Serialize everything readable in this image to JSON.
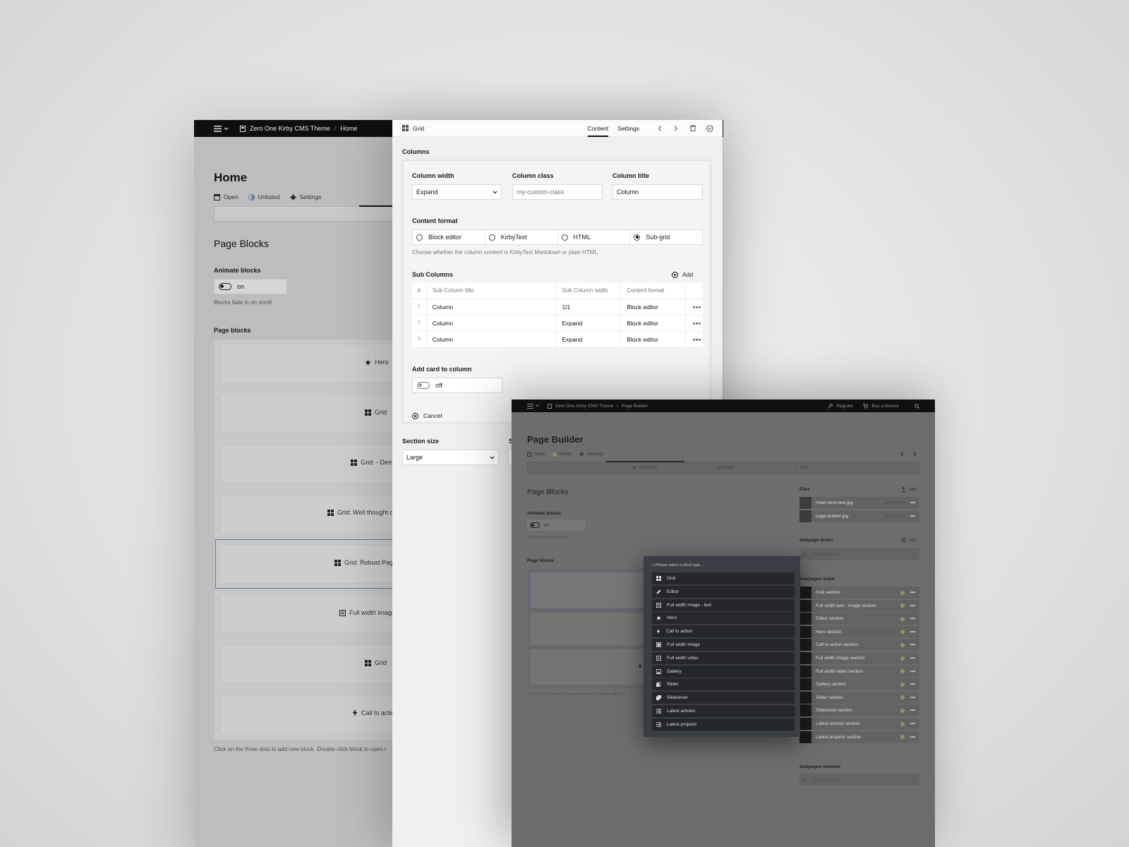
{
  "home": {
    "breadcrumb": [
      "Zero One Kirby CMS Theme",
      "Home"
    ],
    "title": "Home",
    "meta": [
      "Open",
      "Unlisted",
      "Settings"
    ],
    "section_title": "Page Blocks",
    "animate_label": "Animate blocks",
    "animate_value": "on",
    "animate_help": "Blocks fade in on scroll.",
    "blocks_label": "Page blocks",
    "blocks": [
      "Hero",
      "Grid",
      "Grid: - Dem",
      "Grid: Well thought o",
      "Grid: Robust Page",
      "Full width image",
      "Grid",
      "Call to actic"
    ],
    "blocks_help": "Click on the three dots to add new block. Double-click block to open i"
  },
  "grid_drawer": {
    "title": "Grid",
    "tabs": [
      "Content",
      "Settings"
    ],
    "columns_label": "Columns",
    "column_width_label": "Column width",
    "column_width_value": "Expand",
    "column_class_label": "Column class",
    "column_class_placeholder": "my-custom-class",
    "column_title_label": "Column title",
    "column_title_value": "Column",
    "content_format_label": "Content format",
    "content_format_options": [
      "Block editor",
      "KirbyText",
      "HTML",
      "Sub-grid"
    ],
    "content_format_selected": "Sub-grid",
    "content_format_help": "Choose whether the column content is KirbyText Markdown or plain HTML.",
    "sub_columns_label": "Sub Columns",
    "add_label": "Add",
    "sub_columns_headers": [
      "#",
      "Sub Column title",
      "Sub Column width",
      "Content format"
    ],
    "sub_columns_rows": [
      {
        "num": "1",
        "title": "Column",
        "width": "1/1",
        "format": "Block editor"
      },
      {
        "num": "2",
        "title": "Column",
        "width": "Expand",
        "format": "Block editor"
      },
      {
        "num": "3",
        "title": "Column",
        "width": "Expand",
        "format": "Block editor"
      }
    ],
    "add_card_label": "Add card to column",
    "add_card_value": "off",
    "cancel_label": "Cancel",
    "section_size_label": "Section size",
    "section_size_value": "Large",
    "second_label_fragment": "S"
  },
  "page_builder": {
    "breadcrumb": [
      "Zero One Kirby CMS Theme",
      "Page Builder"
    ],
    "register_label": "Register",
    "buy_label": "Buy a license",
    "title": "Page Builder",
    "meta": [
      "Open",
      "Public",
      "Settings"
    ],
    "tabs": [
      "CONTENT",
      "HEADER",
      "SEO"
    ],
    "section_title": "Page Blocks",
    "animate_label": "Animate blocks",
    "animate_value": "on",
    "animate_help": "Blocks fade in on scroll.",
    "blocks_label": "Page blocks",
    "blocks_help": "Click on the three dots to add new block. Double-click blo",
    "files_label": "Files",
    "files_add": "Add",
    "files": [
      {
        "name": "meet-zero-one.jpg",
        "size": "1800 × 1200"
      },
      {
        "name": "page-builder.jpg",
        "size": "1800 × 1201"
      }
    ],
    "drafts_label": "Subpage drafts",
    "drafts_add": "Add",
    "drafts_empty": "No pages yet",
    "listed_label": "Subpages listed",
    "listed": [
      "Grid section",
      "Full width text - image section",
      "Editor section",
      "Hero section",
      "Call to action section",
      "Full width image section",
      "Full width video section",
      "Gallery section",
      "Slider section",
      "Slideshow section",
      "Latest articles section",
      "Latest projects section"
    ],
    "unlisted_label": "Subpages unlisted",
    "unlisted_empty": "No pages yet",
    "menu_title": "Please select a block type ...",
    "menu_items": [
      {
        "label": "Grid",
        "icon": "grid-icon"
      },
      {
        "label": "Editor",
        "icon": "pen-icon"
      },
      {
        "label": "Full width image - text",
        "icon": "image-text-icon"
      },
      {
        "label": "Hero",
        "icon": "star-icon"
      },
      {
        "label": "Call to action",
        "icon": "bolt-icon"
      },
      {
        "label": "Full width image",
        "icon": "image-icon"
      },
      {
        "label": "Full width video",
        "icon": "video-icon"
      },
      {
        "label": "Gallery",
        "icon": "gallery-icon"
      },
      {
        "label": "Slider",
        "icon": "slider-icon"
      },
      {
        "label": "Slideshow",
        "icon": "slideshow-icon"
      },
      {
        "label": "Latest articles",
        "icon": "list-icon"
      },
      {
        "label": "Latest projects",
        "icon": "list-icon"
      }
    ]
  }
}
